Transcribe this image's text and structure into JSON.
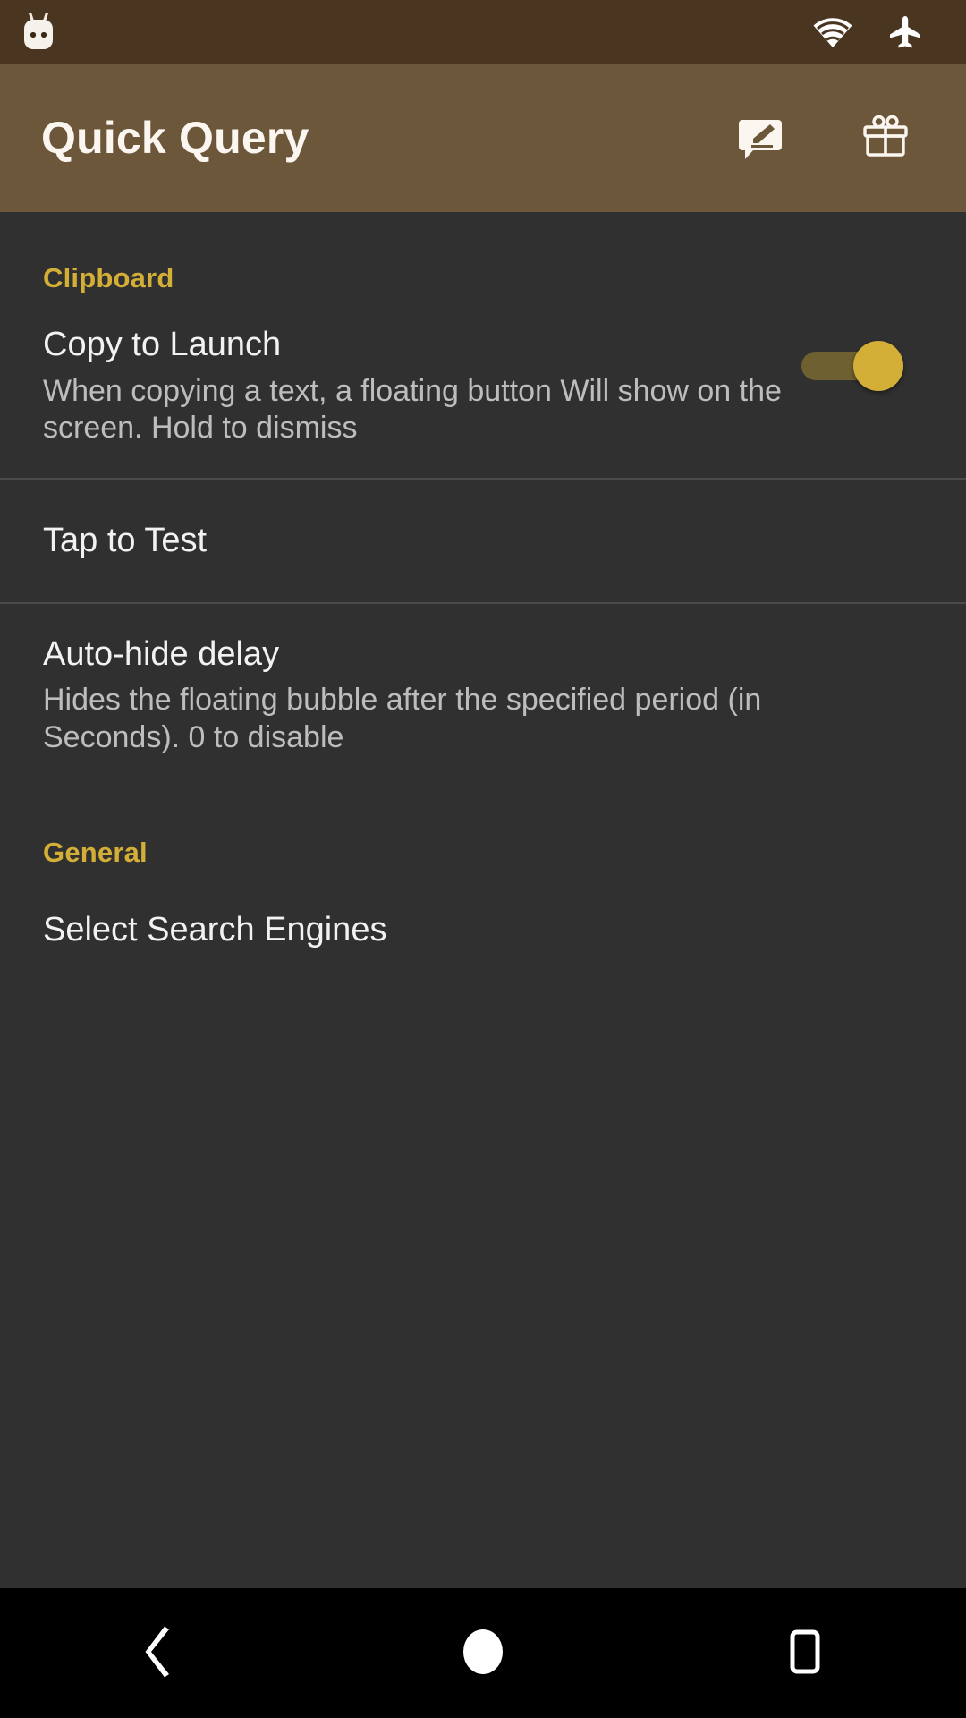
{
  "status_bar": {
    "left_icons": [
      {
        "name": "android-marshmallow-icon",
        "label": "Android"
      }
    ],
    "right_icons": [
      {
        "name": "wifi-icon",
        "label": "Wi-Fi"
      },
      {
        "name": "airplane-mode-icon",
        "label": "Airplane mode"
      }
    ],
    "background_color": "#4a3520"
  },
  "toolbar": {
    "title": "Quick Query",
    "background_color": "#6d573b",
    "title_color": "#fbf7f0",
    "actions": [
      {
        "name": "feedback-icon",
        "label": "Feedback"
      },
      {
        "name": "gift-icon",
        "label": "Gift"
      }
    ]
  },
  "theme": {
    "background": "#303030",
    "accent": "#d4af37",
    "primary_text": "#f2f2f2",
    "secondary_text": "#bdbdbd",
    "divider": "#4a4a4a"
  },
  "sections": [
    {
      "header": "Clipboard",
      "items": [
        {
          "title": "Copy to Launch",
          "summary": "When copying a text, a floating button Will show on the screen. Hold to dismiss",
          "widget": "switch",
          "checked": true
        },
        {
          "title": "Tap to Test",
          "summary": "",
          "widget": "none"
        },
        {
          "title": "Auto-hide delay",
          "summary": "Hides the floating bubble after the specified period (in Seconds). 0 to disable",
          "widget": "none"
        }
      ]
    },
    {
      "header": "General",
      "items": [
        {
          "title": "Select Search Engines",
          "summary": "",
          "widget": "none"
        }
      ]
    }
  ],
  "nav_bar": {
    "buttons": [
      {
        "name": "back-button",
        "label": "Back"
      },
      {
        "name": "home-button",
        "label": "Home"
      },
      {
        "name": "recents-button",
        "label": "Recents"
      }
    ]
  }
}
